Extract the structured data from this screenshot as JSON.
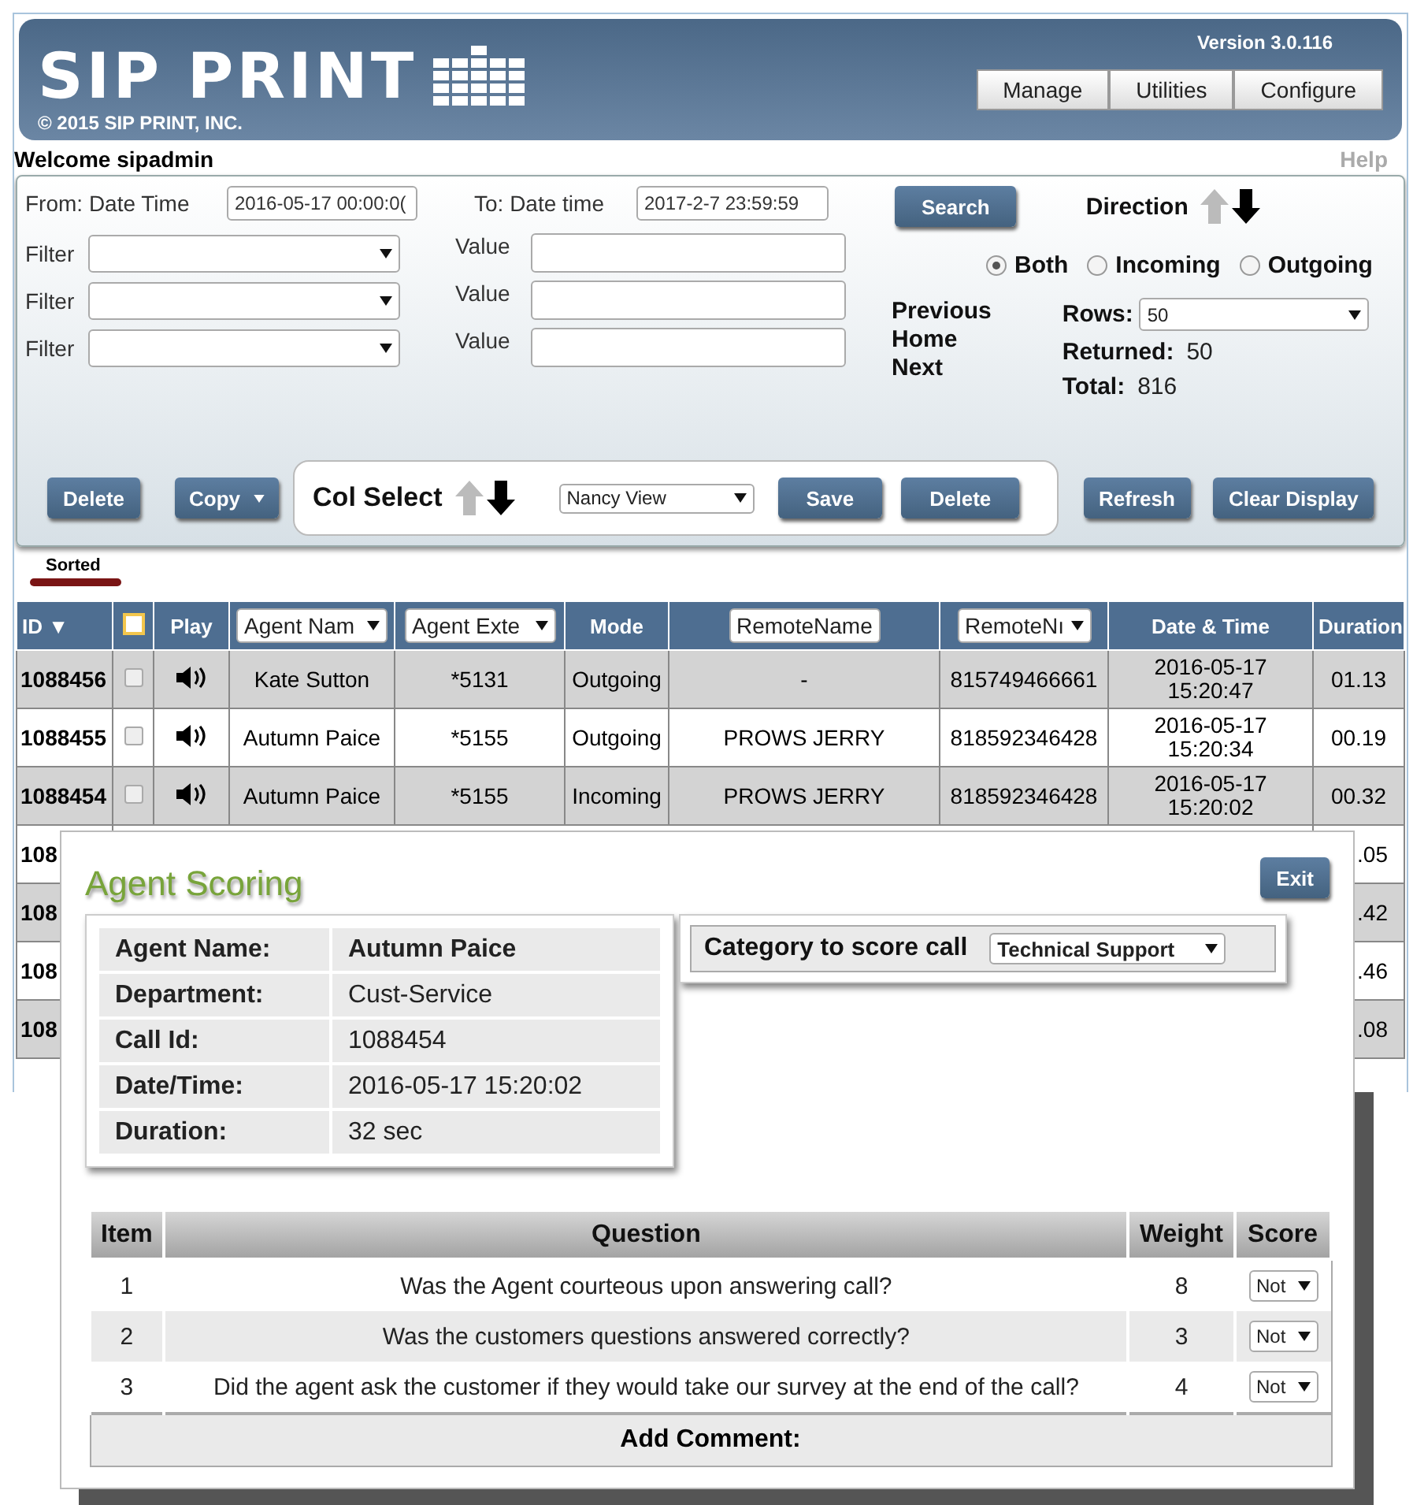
{
  "header": {
    "logo": "SIP PRINT",
    "copyright": "© 2015 SIP PRINT, INC.",
    "version": "Version 3.0.116",
    "nav": [
      "Manage",
      "Utilities",
      "Configure"
    ]
  },
  "welcome": "Welcome sipadmin",
  "help": "Help",
  "search_panel": {
    "from_label": "From: Date Time",
    "from_value": "2016-05-17 00:00:0(",
    "to_label": "To: Date time",
    "to_value": "2017-2-7 23:59:59",
    "filters": [
      {
        "label": "Filter",
        "value_label": "Value"
      },
      {
        "label": "Filter",
        "value_label": "Value"
      },
      {
        "label": "Filter",
        "value_label": "Value"
      }
    ],
    "search_button": "Search",
    "direction_label": "Direction",
    "direction_descending": true,
    "direction_options": [
      {
        "label": "Both",
        "selected": true
      },
      {
        "label": "Incoming",
        "selected": false
      },
      {
        "label": "Outgoing",
        "selected": false
      }
    ],
    "paging": [
      "Previous",
      "Home",
      "Next"
    ],
    "rows_label": "Rows:",
    "rows_value": "50",
    "returned_label": "Returned:",
    "returned_value": "50",
    "total_label": "Total:",
    "total_value": "816",
    "delete_button": "Delete",
    "copy_button": "Copy",
    "col_select_label": "Col Select",
    "col_select_descending": true,
    "view_value": "Nancy View",
    "save_button": "Save",
    "view_delete_button": "Delete",
    "refresh_button": "Refresh",
    "clear_button": "Clear Display"
  },
  "sorted_label": "Sorted",
  "table": {
    "columns": [
      {
        "label": "ID",
        "kind": "sort",
        "sort_mark": "▼"
      },
      {
        "kind": "checkbox",
        "checked": false
      },
      {
        "label": "Play",
        "kind": "text"
      },
      {
        "label": "Agent Nam",
        "kind": "select"
      },
      {
        "label": "Agent Exte",
        "kind": "select"
      },
      {
        "label": "Mode",
        "kind": "text"
      },
      {
        "label": "RemoteName",
        "kind": "select"
      },
      {
        "label": "RemoteNı",
        "kind": "select"
      },
      {
        "label": "Date & Time",
        "kind": "text"
      },
      {
        "label": "Duration",
        "kind": "text"
      }
    ],
    "rows": [
      {
        "kind": "full",
        "id": "1088456",
        "checked": false,
        "agent": "Kate Sutton",
        "extension": "*5131",
        "mode": "Outgoing",
        "remote_name": "-",
        "remote_number": "815749466661",
        "date": "2016-05-17",
        "time": "15:20:47",
        "duration": "01.13"
      },
      {
        "kind": "full",
        "id": "1088455",
        "checked": false,
        "agent": "Autumn Paice",
        "extension": "*5155",
        "mode": "Outgoing",
        "remote_name": "PROWS JERRY",
        "remote_number": "818592346428",
        "date": "2016-05-17",
        "time": "15:20:34",
        "duration": "00.19"
      },
      {
        "kind": "full",
        "id": "1088454",
        "checked": false,
        "agent": "Autumn Paice",
        "extension": "*5155",
        "mode": "Incoming",
        "remote_name": "PROWS JERRY",
        "remote_number": "818592346428",
        "date": "2016-05-17",
        "time": "15:20:02",
        "duration": "00.32"
      },
      {
        "kind": "partial",
        "id": "108",
        "duration": ".05"
      },
      {
        "kind": "partial",
        "id": "108",
        "duration": ".42"
      },
      {
        "kind": "partial",
        "id": "108",
        "duration": ".46"
      },
      {
        "kind": "partial",
        "id": "108",
        "duration": ".08"
      }
    ]
  },
  "modal": {
    "title": "Agent Scoring",
    "exit_button": "Exit",
    "info": [
      {
        "label": "Agent Name:",
        "value": "Autumn Paice",
        "bold": true
      },
      {
        "label": "Department:",
        "value": "Cust-Service",
        "bold": false
      },
      {
        "label": "Call Id:",
        "value": "1088454",
        "bold": false
      },
      {
        "label": "Date/Time:",
        "value": "2016-05-17 15:20:02",
        "bold": false
      },
      {
        "label": "Duration:",
        "value": "32 sec",
        "bold": false
      }
    ],
    "category_label": "Category to score call",
    "category_value": "Technical Support",
    "questions": {
      "columns": [
        "Item",
        "Question",
        "Weight",
        "Score"
      ],
      "rows": [
        {
          "item": "1",
          "question": "Was the Agent courteous upon answering call?",
          "weight": "8",
          "score": "Not"
        },
        {
          "item": "2",
          "question": "Was the customers questions answered correctly?",
          "weight": "3",
          "score": "Not"
        },
        {
          "item": "3",
          "question": "Did the agent ask the customer if they would take our survey at the end of the call?",
          "weight": "4",
          "score": "Not"
        }
      ],
      "footer": "Add Comment:"
    }
  }
}
